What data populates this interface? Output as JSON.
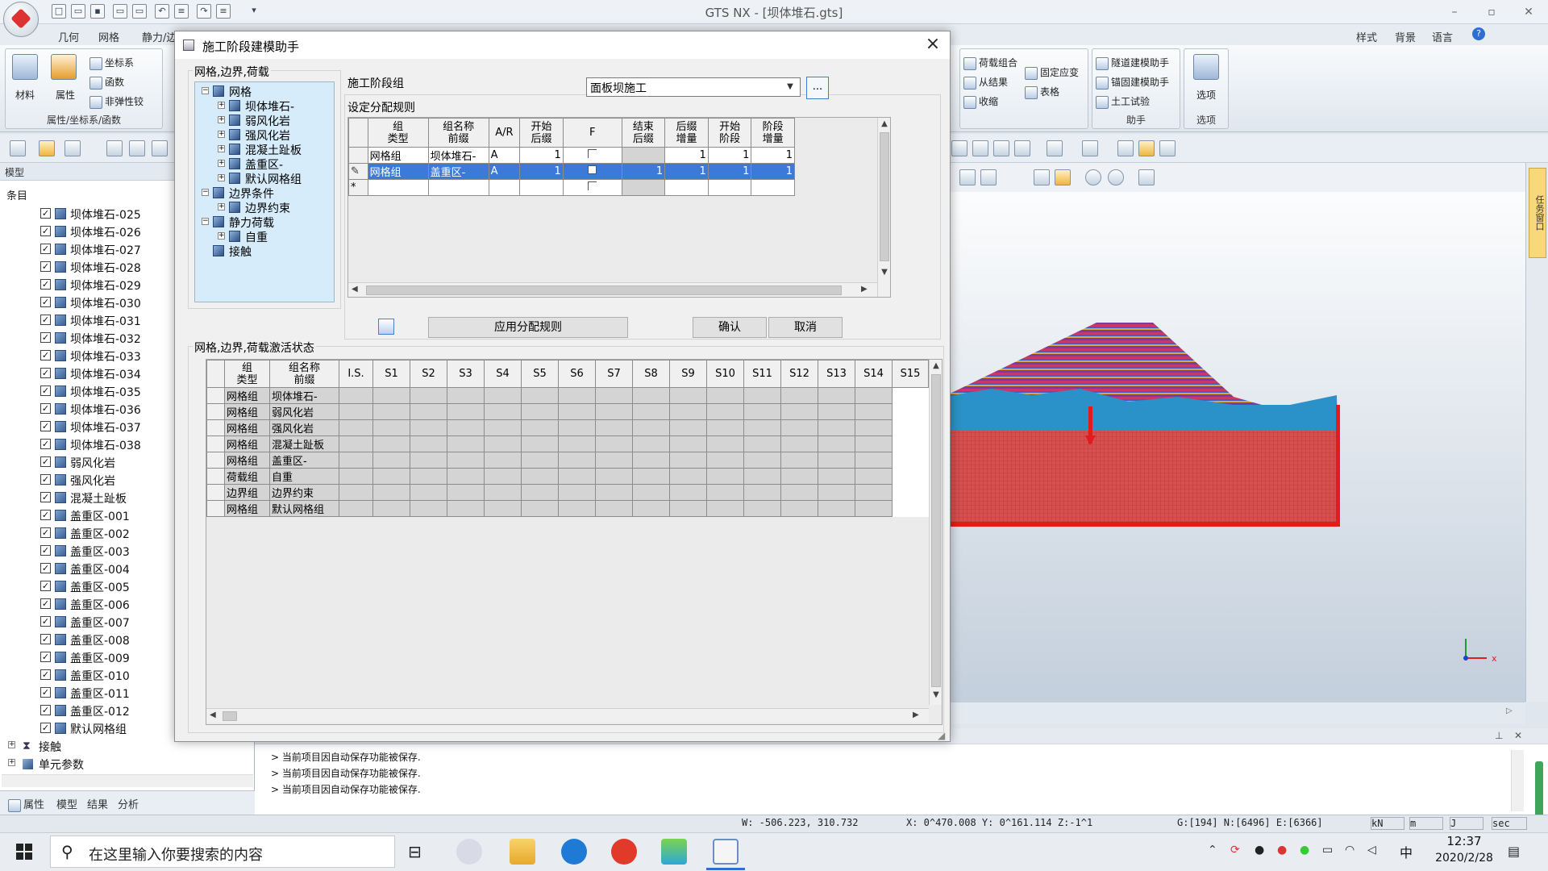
{
  "titlebar": {
    "app_title": "GTS NX - [坝体堆石.gts]",
    "min": "–",
    "restore": "▫",
    "close": "✕"
  },
  "ribbon": {
    "tabs": [
      "几何",
      "网格",
      "静力/边"
    ],
    "right_links": {
      "style": "样式",
      "bg": "背景",
      "lang": "语言"
    },
    "group_props": {
      "material": "材料",
      "property": "属性",
      "coord": "坐标系",
      "func": "函数",
      "nonlinear": "非弹性铰",
      "label": "属性/坐标系/函数"
    },
    "group_load": {
      "load_combo": "荷载组合",
      "fixed_stress": "固定应变",
      "from_result": "从结果",
      "table": "表格",
      "shrink": "收缩"
    },
    "group_helper": {
      "tunnel": "隧道建模助手",
      "anchor": "锚固建模助手",
      "soil": "土工试验",
      "label": "助手"
    },
    "group_option": {
      "option": "选项",
      "label": "选项"
    }
  },
  "left_panel": {
    "header": "模型",
    "subheader": "条目",
    "items": [
      "坝体堆石-025",
      "坝体堆石-026",
      "坝体堆石-027",
      "坝体堆石-028",
      "坝体堆石-029",
      "坝体堆石-030",
      "坝体堆石-031",
      "坝体堆石-032",
      "坝体堆石-033",
      "坝体堆石-034",
      "坝体堆石-035",
      "坝体堆石-036",
      "坝体堆石-037",
      "坝体堆石-038",
      "弱风化岩",
      "强风化岩",
      "混凝土趾板",
      "盖重区-001",
      "盖重区-002",
      "盖重区-003",
      "盖重区-004",
      "盖重区-005",
      "盖重区-006",
      "盖重区-007",
      "盖重区-008",
      "盖重区-009",
      "盖重区-010",
      "盖重区-011",
      "盖重区-012",
      "默认网格组"
    ],
    "contact": "接触",
    "elem_param": "单元参数",
    "tabs": [
      "属性",
      "模型",
      "结果",
      "分析"
    ]
  },
  "log": {
    "lines": [
      "> 当前项目因自动保存功能被保存.",
      "> 当前项目因自动保存功能被保存.",
      "> 当前项目因自动保存功能被保存."
    ]
  },
  "viewport": {
    "side_tab": "任务窗口"
  },
  "status": {
    "w": "W: -506.223, 310.732",
    "xyz": "X: 0^470.008 Y: 0^161.114 Z:-1^1",
    "g": "G:[194] N:[6496] E:[6366]",
    "unit_force": "kN",
    "unit_len": "m",
    "unit_energy": "J",
    "unit_time": "sec"
  },
  "taskbar": {
    "search_placeholder": "在这里输入你要搜索的内容",
    "time": "12:37",
    "date": "2020/2/28",
    "ime": "中"
  },
  "dialog": {
    "title": "施工阶段建模助手",
    "tree_section": "网格,边界,荷载",
    "tree": {
      "mesh": "网格",
      "mesh_items": [
        "坝体堆石-",
        "弱风化岩",
        "强风化岩",
        "混凝土趾板",
        "盖重区-",
        "默认网格组"
      ],
      "boundary": "边界条件",
      "boundary_items": [
        "边界约束"
      ],
      "static": "静力荷载",
      "static_items": [
        "自重"
      ],
      "contact": "接触"
    },
    "stage_group_label": "施工阶段组",
    "stage_group_value": "面板坝施工",
    "dots": "...",
    "rules_label": "设定分配规则",
    "rules_headers": [
      "组\n类型",
      "组名称\n前缀",
      "A/R",
      "开始\n后缀",
      "F",
      "结束\n后缀",
      "后缀\n增量",
      "开始\n阶段",
      "阶段\n增量"
    ],
    "rules_rows": [
      {
        "type": "网格组",
        "prefix": "坝体堆石-",
        "ar": "A",
        "start": "1",
        "end": "",
        "inc": "1",
        "stage": "1",
        "stage_inc": "1"
      },
      {
        "type": "网格组",
        "prefix": "盖重区-",
        "ar": "A",
        "start": "1",
        "end": "1",
        "inc": "1",
        "stage": "1",
        "stage_inc": "1"
      }
    ],
    "new_row_marker": "*",
    "apply_button": "应用分配规则",
    "ok_button": "确认",
    "cancel_button": "取消",
    "activation_label": "网格,边界,荷载激活状态",
    "act_headers": [
      "组\n类型",
      "组名称\n前缀",
      "I.S.",
      "S1",
      "S2",
      "S3",
      "S4",
      "S5",
      "S6",
      "S7",
      "S8",
      "S9",
      "S10",
      "S11",
      "S12",
      "S13",
      "S14",
      "S15"
    ],
    "act_rows": [
      {
        "type": "网格组",
        "name": "坝体堆石-"
      },
      {
        "type": "网格组",
        "name": "弱风化岩"
      },
      {
        "type": "网格组",
        "name": "强风化岩"
      },
      {
        "type": "网格组",
        "name": "混凝土趾板"
      },
      {
        "type": "网格组",
        "name": "盖重区-"
      },
      {
        "type": "荷载组",
        "name": "自重"
      },
      {
        "type": "边界组",
        "name": "边界约束"
      },
      {
        "type": "网格组",
        "name": "默认网格组"
      }
    ]
  }
}
